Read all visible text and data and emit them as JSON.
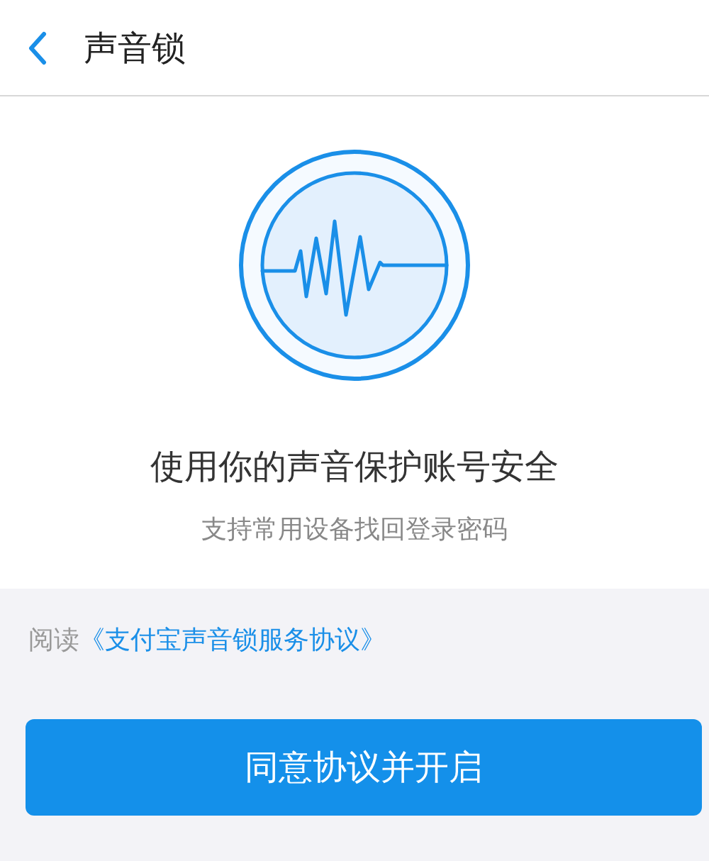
{
  "header": {
    "title": "声音锁"
  },
  "hero": {
    "title": "使用你的声音保护账号安全",
    "subtitle": "支持常用设备找回登录密码"
  },
  "agreement": {
    "prefix": "阅读",
    "link": "《支付宝声音锁服务协议》"
  },
  "button": {
    "label": "同意协议并开启"
  }
}
